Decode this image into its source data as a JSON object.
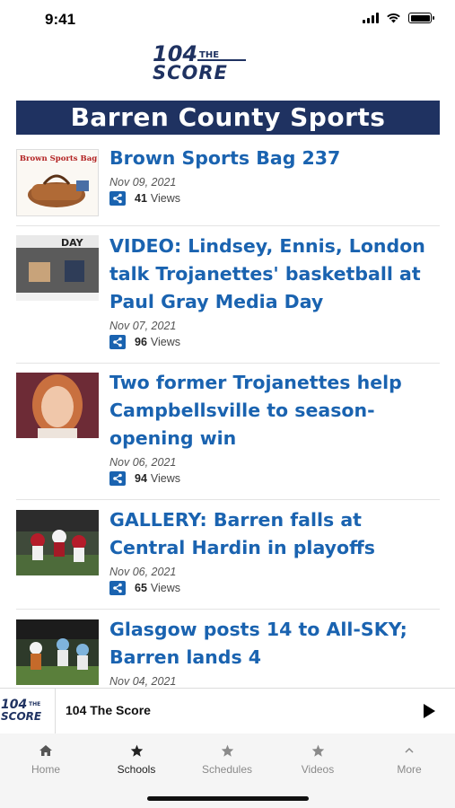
{
  "status_bar": {
    "time": "9:41"
  },
  "brand": {
    "logo_text_top": "104",
    "logo_text_small": "THE",
    "logo_text_bottom": "SCORE",
    "accent_color": "#1f3261",
    "link_color": "#1a63b0"
  },
  "section": {
    "title": "Barren County Sports"
  },
  "articles": [
    {
      "title": "Brown Sports Bag 237",
      "date": "Nov 09, 2021",
      "views": "41",
      "views_label": "Views",
      "thumb_caption": "Brown Sports Bag",
      "thumb_icon": "duffel-bag-image"
    },
    {
      "title": "VIDEO: Lindsey, Ennis, London talk Trojanettes' basketball at Paul Gray Media Day",
      "date": "Nov 07, 2021",
      "views": "96",
      "views_label": "Views",
      "thumb_caption": "DAY",
      "thumb_icon": "media-day-image"
    },
    {
      "title": "Two former Trojanettes help Campbellsville to season-opening win",
      "date": "Nov 06, 2021",
      "views": "94",
      "views_label": "Views",
      "thumb_icon": "player-portrait-image"
    },
    {
      "title": "GALLERY: Barren falls at Central Hardin in playoffs",
      "date": "Nov 06, 2021",
      "views": "65",
      "views_label": "Views",
      "thumb_icon": "football-game-image"
    },
    {
      "title": "Glasgow posts 14 to All-SKY; Barren lands 4",
      "date": "Nov 04, 2021",
      "thumb_icon": "football-players-image"
    }
  ],
  "player": {
    "station_name": "104 The Score",
    "icon": "play-icon"
  },
  "tabs": [
    {
      "label": "Home",
      "icon": "home-icon"
    },
    {
      "label": "Schools",
      "icon": "star-icon",
      "active": true
    },
    {
      "label": "Schedules",
      "icon": "star-icon"
    },
    {
      "label": "Videos",
      "icon": "star-icon"
    },
    {
      "label": "More",
      "icon": "chevron-up-icon"
    }
  ]
}
